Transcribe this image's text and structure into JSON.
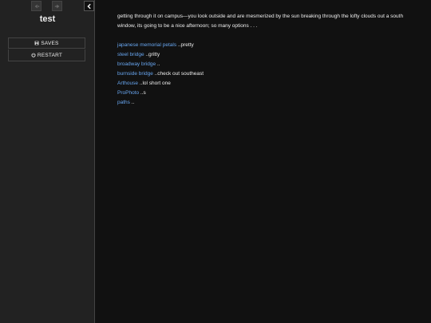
{
  "sidebar": {
    "title": "test",
    "menu": {
      "saves_label": "SAVES",
      "restart_label": "RESTART"
    },
    "icons": {
      "back": "arrow-left-icon",
      "forward": "arrow-right-icon",
      "toggle": "chevron-left-icon",
      "saves": "floppy-disk-icon",
      "restart": "power-icon"
    }
  },
  "passage": {
    "intro": "getting through it on campus—you look outside and are mesmerized by the sun breaking through the lofty clouds out a south window, its going to be a nice afternoon; so many options . . .",
    "options": [
      {
        "link": "japanese memorial petals",
        "note": " ..pretty"
      },
      {
        "link": "steel bridge",
        "note": " ..gritty"
      },
      {
        "link": "broadway bridge",
        "note": " .."
      },
      {
        "link": "burnside bridge",
        "note": " ..check out southeast"
      },
      {
        "link": "Arthouse",
        "note": " ..lol short one"
      },
      {
        "link": "ProPhoto",
        "note": " ..s"
      },
      {
        "link": "paths",
        "note": " .."
      }
    ]
  },
  "colors": {
    "background": "#111111",
    "sidebar": "#222222",
    "link": "#68a6f0",
    "text": "#eeeeee"
  }
}
